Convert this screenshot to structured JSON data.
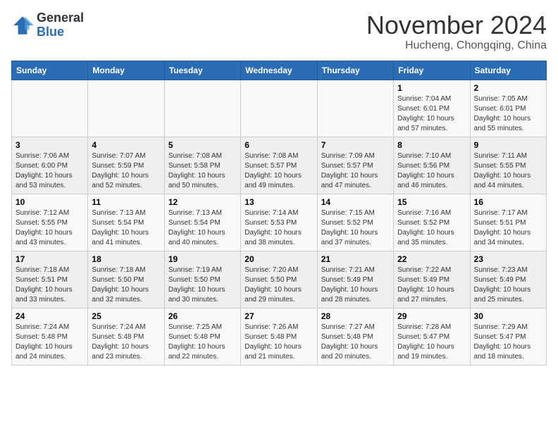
{
  "logo": {
    "general": "General",
    "blue": "Blue"
  },
  "header": {
    "month": "November 2024",
    "location": "Hucheng, Chongqing, China"
  },
  "days_of_week": [
    "Sunday",
    "Monday",
    "Tuesday",
    "Wednesday",
    "Thursday",
    "Friday",
    "Saturday"
  ],
  "weeks": [
    [
      {
        "day": "",
        "info": ""
      },
      {
        "day": "",
        "info": ""
      },
      {
        "day": "",
        "info": ""
      },
      {
        "day": "",
        "info": ""
      },
      {
        "day": "",
        "info": ""
      },
      {
        "day": "1",
        "info": "Sunrise: 7:04 AM\nSunset: 6:01 PM\nDaylight: 10 hours and 57 minutes."
      },
      {
        "day": "2",
        "info": "Sunrise: 7:05 AM\nSunset: 6:01 PM\nDaylight: 10 hours and 55 minutes."
      }
    ],
    [
      {
        "day": "3",
        "info": "Sunrise: 7:06 AM\nSunset: 6:00 PM\nDaylight: 10 hours and 53 minutes."
      },
      {
        "day": "4",
        "info": "Sunrise: 7:07 AM\nSunset: 5:59 PM\nDaylight: 10 hours and 52 minutes."
      },
      {
        "day": "5",
        "info": "Sunrise: 7:08 AM\nSunset: 5:58 PM\nDaylight: 10 hours and 50 minutes."
      },
      {
        "day": "6",
        "info": "Sunrise: 7:08 AM\nSunset: 5:57 PM\nDaylight: 10 hours and 49 minutes."
      },
      {
        "day": "7",
        "info": "Sunrise: 7:09 AM\nSunset: 5:57 PM\nDaylight: 10 hours and 47 minutes."
      },
      {
        "day": "8",
        "info": "Sunrise: 7:10 AM\nSunset: 5:56 PM\nDaylight: 10 hours and 46 minutes."
      },
      {
        "day": "9",
        "info": "Sunrise: 7:11 AM\nSunset: 5:55 PM\nDaylight: 10 hours and 44 minutes."
      }
    ],
    [
      {
        "day": "10",
        "info": "Sunrise: 7:12 AM\nSunset: 5:55 PM\nDaylight: 10 hours and 43 minutes."
      },
      {
        "day": "11",
        "info": "Sunrise: 7:13 AM\nSunset: 5:54 PM\nDaylight: 10 hours and 41 minutes."
      },
      {
        "day": "12",
        "info": "Sunrise: 7:13 AM\nSunset: 5:54 PM\nDaylight: 10 hours and 40 minutes."
      },
      {
        "day": "13",
        "info": "Sunrise: 7:14 AM\nSunset: 5:53 PM\nDaylight: 10 hours and 38 minutes."
      },
      {
        "day": "14",
        "info": "Sunrise: 7:15 AM\nSunset: 5:52 PM\nDaylight: 10 hours and 37 minutes."
      },
      {
        "day": "15",
        "info": "Sunrise: 7:16 AM\nSunset: 5:52 PM\nDaylight: 10 hours and 35 minutes."
      },
      {
        "day": "16",
        "info": "Sunrise: 7:17 AM\nSunset: 5:51 PM\nDaylight: 10 hours and 34 minutes."
      }
    ],
    [
      {
        "day": "17",
        "info": "Sunrise: 7:18 AM\nSunset: 5:51 PM\nDaylight: 10 hours and 33 minutes."
      },
      {
        "day": "18",
        "info": "Sunrise: 7:18 AM\nSunset: 5:50 PM\nDaylight: 10 hours and 32 minutes."
      },
      {
        "day": "19",
        "info": "Sunrise: 7:19 AM\nSunset: 5:50 PM\nDaylight: 10 hours and 30 minutes."
      },
      {
        "day": "20",
        "info": "Sunrise: 7:20 AM\nSunset: 5:50 PM\nDaylight: 10 hours and 29 minutes."
      },
      {
        "day": "21",
        "info": "Sunrise: 7:21 AM\nSunset: 5:49 PM\nDaylight: 10 hours and 28 minutes."
      },
      {
        "day": "22",
        "info": "Sunrise: 7:22 AM\nSunset: 5:49 PM\nDaylight: 10 hours and 27 minutes."
      },
      {
        "day": "23",
        "info": "Sunrise: 7:23 AM\nSunset: 5:49 PM\nDaylight: 10 hours and 25 minutes."
      }
    ],
    [
      {
        "day": "24",
        "info": "Sunrise: 7:24 AM\nSunset: 5:48 PM\nDaylight: 10 hours and 24 minutes."
      },
      {
        "day": "25",
        "info": "Sunrise: 7:24 AM\nSunset: 5:48 PM\nDaylight: 10 hours and 23 minutes."
      },
      {
        "day": "26",
        "info": "Sunrise: 7:25 AM\nSunset: 5:48 PM\nDaylight: 10 hours and 22 minutes."
      },
      {
        "day": "27",
        "info": "Sunrise: 7:26 AM\nSunset: 5:48 PM\nDaylight: 10 hours and 21 minutes."
      },
      {
        "day": "28",
        "info": "Sunrise: 7:27 AM\nSunset: 5:48 PM\nDaylight: 10 hours and 20 minutes."
      },
      {
        "day": "29",
        "info": "Sunrise: 7:28 AM\nSunset: 5:47 PM\nDaylight: 10 hours and 19 minutes."
      },
      {
        "day": "30",
        "info": "Sunrise: 7:29 AM\nSunset: 5:47 PM\nDaylight: 10 hours and 18 minutes."
      }
    ]
  ]
}
